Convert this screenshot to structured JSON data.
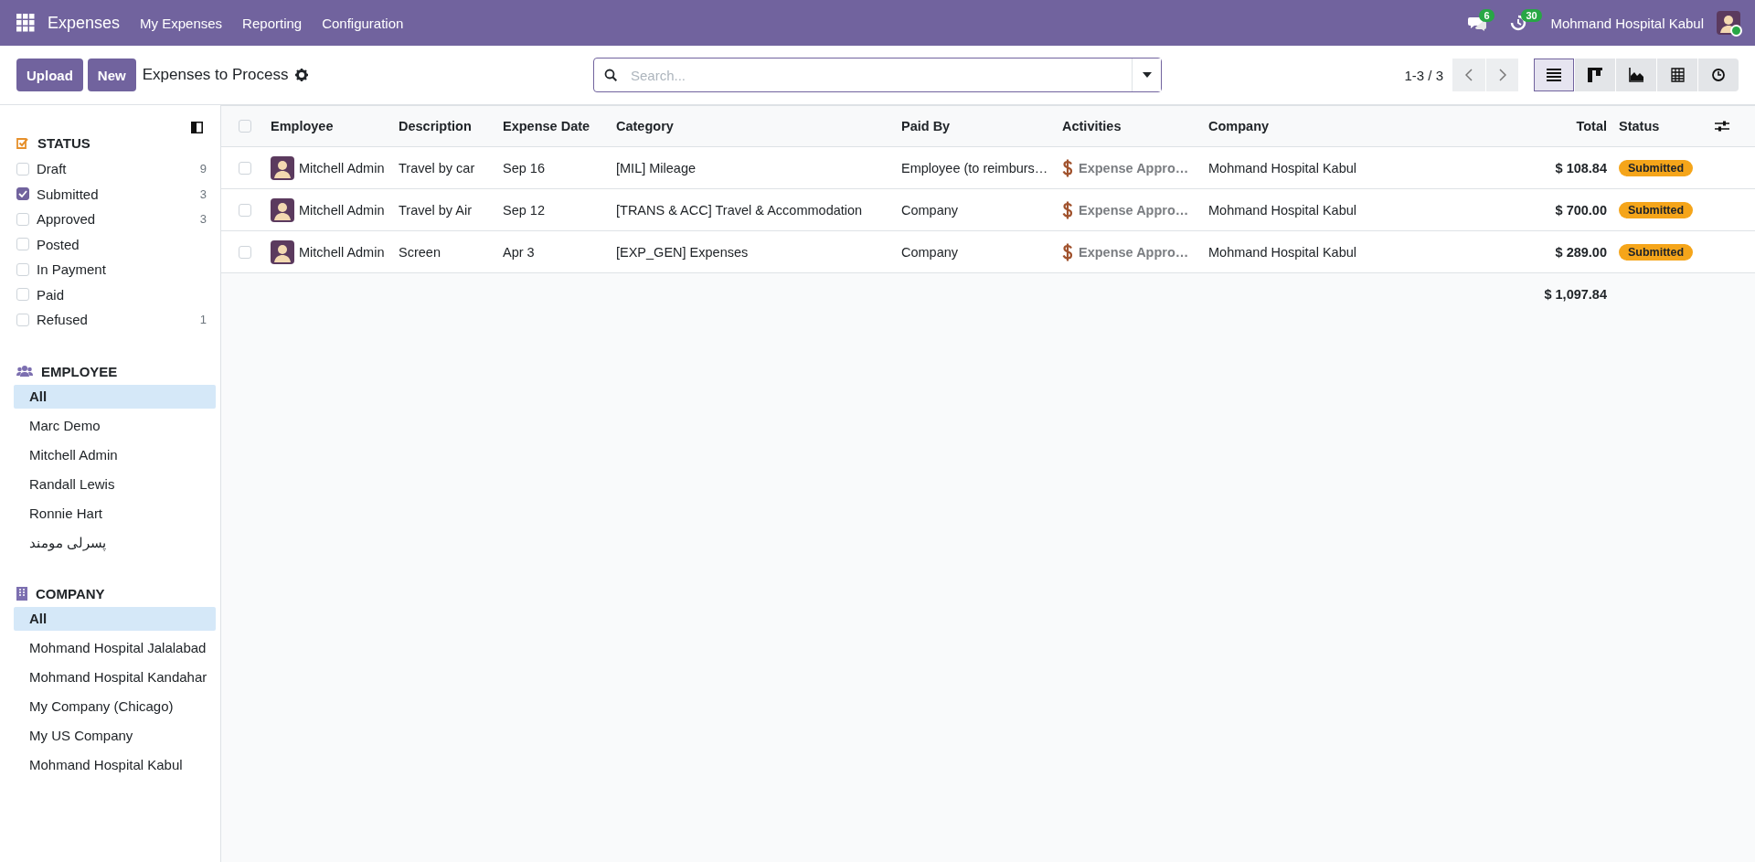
{
  "navbar": {
    "app_name": "Expenses",
    "menu": [
      "My Expenses",
      "Reporting",
      "Configuration"
    ],
    "messages_count": "6",
    "activities_count": "30",
    "company": "Mohmand Hospital Kabul"
  },
  "control_panel": {
    "buttons": [
      "Upload",
      "New"
    ],
    "title": "Expenses to Process",
    "search": {
      "placeholder": "Search..."
    },
    "pager": "1-3 / 3",
    "views": [
      {
        "kind": "list",
        "selected": true
      },
      {
        "kind": "kanban",
        "selected": false
      },
      {
        "kind": "graph",
        "selected": false
      },
      {
        "kind": "pivot",
        "selected": false
      },
      {
        "kind": "activity",
        "selected": false
      }
    ]
  },
  "sidebar": {
    "sections": [
      {
        "kind": "checkboxes",
        "title": "STATUS",
        "items": [
          {
            "label": "Draft",
            "count": "9",
            "checked": false
          },
          {
            "label": "Submitted",
            "count": "3",
            "checked": true
          },
          {
            "label": "Approved",
            "count": "3",
            "checked": false
          },
          {
            "label": "Posted",
            "checked": false
          },
          {
            "label": "In Payment",
            "checked": false
          },
          {
            "label": "Paid",
            "checked": false
          },
          {
            "label": "Refused",
            "count": "1",
            "checked": false
          }
        ]
      },
      {
        "kind": "list",
        "title": "EMPLOYEE",
        "items": [
          {
            "label": "All",
            "selected": true
          },
          {
            "label": "Marc Demo",
            "selected": false
          },
          {
            "label": "Mitchell Admin",
            "selected": false
          },
          {
            "label": "Randall Lewis",
            "selected": false
          },
          {
            "label": "Ronnie Hart",
            "selected": false
          },
          {
            "label": "پسرلی مومند",
            "selected": false
          }
        ]
      },
      {
        "kind": "list",
        "title": "COMPANY",
        "items": [
          {
            "label": "All",
            "selected": true
          },
          {
            "label": "Mohmand Hospital Jalalabad",
            "selected": false
          },
          {
            "label": "Mohmand Hospital Kandahar",
            "selected": false
          },
          {
            "label": "My Company (Chicago)",
            "selected": false
          },
          {
            "label": "My US Company",
            "selected": false
          },
          {
            "label": "Mohmand Hospital Kabul",
            "selected": false
          }
        ]
      }
    ]
  },
  "table": {
    "header_checkbox": {
      "checked": false
    },
    "columns": [
      "Employee",
      "Description",
      "Expense Date",
      "Category",
      "Paid By",
      "Activities",
      "Company",
      "Total",
      "Status"
    ],
    "rows": [
      {
        "selected": false,
        "employee": "Mitchell Admin",
        "description": "Travel by car",
        "date": "Sep 16",
        "category": "[MIL] Mileage",
        "paid_by": "Employee (to reimburs…",
        "activity": "Expense Appro…",
        "company": "Mohmand Hospital Kabul",
        "total": "$ 108.84",
        "status": "Submitted"
      },
      {
        "selected": false,
        "employee": "Mitchell Admin",
        "description": "Travel by Air",
        "date": "Sep 12",
        "category": "[TRANS & ACC] Travel & Accommodation",
        "paid_by": "Company",
        "activity": "Expense Appro…",
        "company": "Mohmand Hospital Kabul",
        "total": "$ 700.00",
        "status": "Submitted"
      },
      {
        "selected": false,
        "employee": "Mitchell Admin",
        "description": "Screen",
        "date": "Apr 3",
        "category": "[EXP_GEN] Expenses",
        "paid_by": "Company",
        "activity": "Expense Appro…",
        "company": "Mohmand Hospital Kabul",
        "total": "$ 289.00",
        "status": "Submitted"
      }
    ],
    "total": "$ 1,097.84"
  }
}
